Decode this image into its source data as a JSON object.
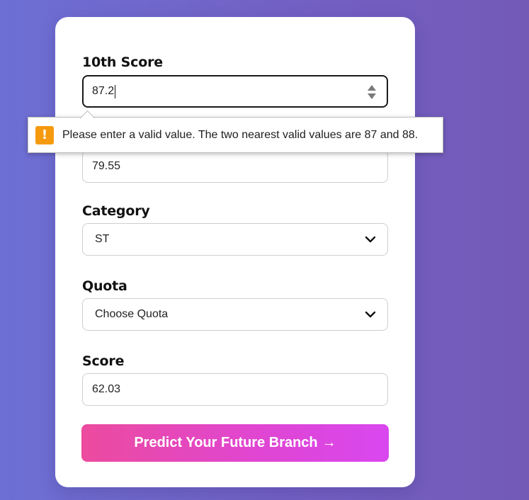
{
  "form": {
    "tenth_score": {
      "label": "10th Score",
      "value": "87.2"
    },
    "twelfth_score": {
      "value": "79.55"
    },
    "category": {
      "label": "Category",
      "selected": "ST"
    },
    "quota": {
      "label": "Quota",
      "selected": "Choose Quota"
    },
    "score": {
      "label": "Score",
      "value": "62.03"
    },
    "submit": {
      "label": "Predict Your Future Branch",
      "arrow": "→"
    }
  },
  "validation_tooltip": {
    "icon": "!",
    "message": "Please enter a valid value. The two nearest valid values are 87 and 88."
  },
  "colors": {
    "warning": "#f59a0f",
    "button_gradient_start": "#ec4b9e",
    "button_gradient_end": "#d947ef",
    "background_start": "#6d6fd4",
    "background_end": "#735ab7"
  },
  "icons": {
    "spinner": "spinner-arrows-icon",
    "dropdown": "chevron-down-icon",
    "warning": "warning-icon",
    "arrow": "arrow-right-icon"
  }
}
